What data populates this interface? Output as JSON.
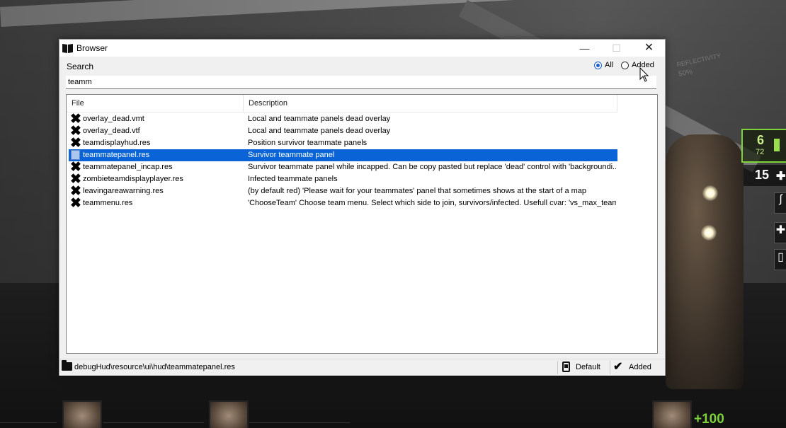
{
  "window": {
    "title": "Browser",
    "controls": {
      "minimize": "—",
      "maximize": "☐",
      "close": "✕"
    }
  },
  "search": {
    "label": "Search",
    "value": "teamm"
  },
  "filter": {
    "all_label": "All",
    "added_label": "Added",
    "selected": "All"
  },
  "table": {
    "columns": [
      "File",
      "Description"
    ],
    "rows": [
      {
        "file": "overlay_dead.vmt",
        "description": "Local and teammate panels dead overlay",
        "icon": "x-icon",
        "selected": false
      },
      {
        "file": "overlay_dead.vtf",
        "description": "Local and teammate panels dead overlay",
        "icon": "x-icon",
        "selected": false
      },
      {
        "file": "teamdisplayhud.res",
        "description": "Position survivor teammate panels",
        "icon": "x-icon",
        "selected": false
      },
      {
        "file": "teammatepanel.res",
        "description": "Survivor teammate panel",
        "icon": "file-icon",
        "selected": true
      },
      {
        "file": "teammatepanel_incap.res",
        "description": "Survivor teammate panel while incapped. Can be copy pasted but replace 'dead' control with 'backgroundi...",
        "icon": "x-icon",
        "selected": false
      },
      {
        "file": "zombieteamdisplayplayer.res",
        "description": "Infected teammate panels",
        "icon": "x-icon",
        "selected": false
      },
      {
        "file": "leavingareawarning.res",
        "description": "(by default red) 'Please wait for your teammates' panel that sometimes shows at the start of a map",
        "icon": "x-icon",
        "selected": false
      },
      {
        "file": "teammenu.res",
        "description": "'ChooseTeam' Choose team menu. Select which side to join, survivors/infected. Usefull cvar: 'vs_max_team...",
        "icon": "x-icon",
        "selected": false
      }
    ]
  },
  "statusbar": {
    "path": "debugHud\\resource\\ui\\hud\\teammatepanel.res",
    "default_label": "Default",
    "added_label": "Added"
  },
  "game_hud": {
    "ammo_clip": "6",
    "ammo_reserve": "72",
    "count": "15",
    "health": "+100",
    "wall_sign": "REFLECTIVITY",
    "wall_percent": "50%"
  },
  "colors": {
    "selection": "#0a64d8",
    "hud_green": "#7ed23a",
    "radio_accent": "#1a5fd6"
  }
}
